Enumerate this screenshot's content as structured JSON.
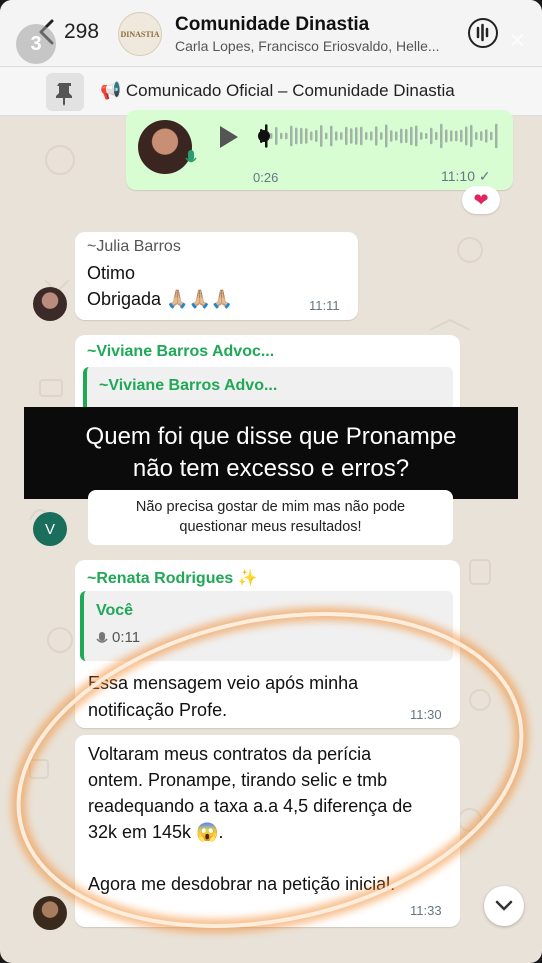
{
  "header": {
    "story_index": "3",
    "unread_count": "298",
    "avatar_text": "DINASTIA",
    "title": "Comunidade Dinastia",
    "members": "Carla Lopes, Francisco Eriosvaldo, Helle..."
  },
  "pinned": {
    "text": "📢 Comunicado Oficial – Comunidade Dinastia"
  },
  "audio_message": {
    "duration": "0:26",
    "time": "11:10 ✓",
    "reaction": "❤"
  },
  "julia_message": {
    "sender": "~Julia Barros",
    "lines": [
      "Otimo",
      "Obrigada 🙏🏼🙏🏼🙏🏼"
    ],
    "time": "11:11"
  },
  "viviane_message": {
    "sender": "~Viviane Barros Advoc...",
    "quoted_sender": "~Viviane Barros Advo...",
    "avatar_letter": "V"
  },
  "overlay": {
    "line1": "Quem foi que disse que Pronampe",
    "line2": "não tem excesso e erros?",
    "sub1": "Não precisa gostar de mim mas não pode",
    "sub2": "questionar meus resultados!"
  },
  "renata_message": {
    "sender": "~Renata Rodrigues ✨",
    "quoted_label": "Você",
    "quoted_duration": "0:11",
    "line1": "Essa mensagem veio após minha",
    "line2": "notificação Profe.",
    "time": "11:30"
  },
  "renata_message_2": {
    "line1": "Voltaram meus contratos da perícia",
    "line2": "ontem. Pronampe, tirando selic e tmb",
    "line3": "readequando a taxa a.a 4,5 diferença de",
    "line4": "32k em 145k 😱.",
    "line5": "Agora me desdobrar na petição inicial.",
    "time": "11:33"
  },
  "colors": {
    "accent_green": "#1fa855",
    "out_bubble": "#d9fdd3",
    "highlight_ring": "#f28a2e"
  }
}
